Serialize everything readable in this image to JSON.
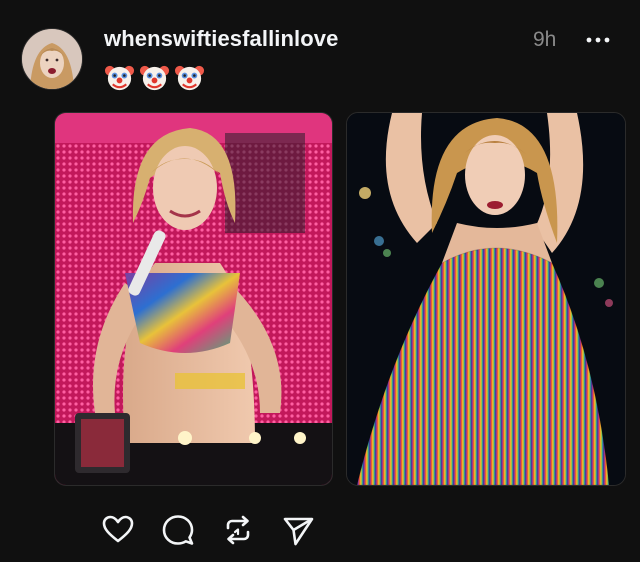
{
  "post": {
    "username": "whenswiftiesfallinlove",
    "time": "9h",
    "emoji_text": "🤡🤡🤡"
  },
  "icons": {
    "avatar": "profile-avatar",
    "more": "more-dots-icon",
    "like": "heart-icon",
    "reply": "comment-bubble-icon",
    "repost": "repost-icon",
    "share": "send-icon"
  },
  "colors": {
    "background": "#101010",
    "text_primary": "#f3f5f7",
    "text_secondary": "#8a8a8a"
  }
}
